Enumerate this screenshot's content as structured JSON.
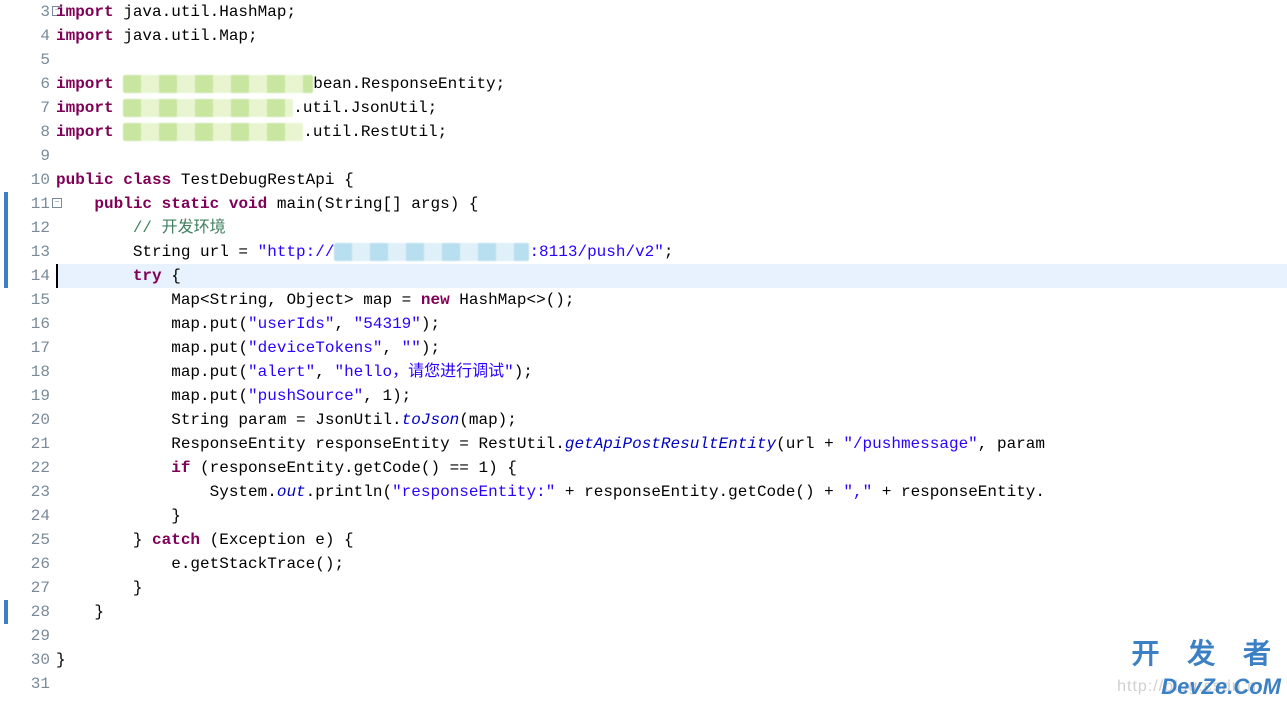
{
  "gutter": {
    "start": 3,
    "end": 31,
    "fold_lines": [
      3,
      11
    ],
    "blue_marker_lines": [
      11,
      12,
      13,
      14,
      28
    ]
  },
  "current_line": 14,
  "code": {
    "l3": {
      "kw": "import",
      "rest": " java.util.HashMap;"
    },
    "l4": {
      "kw": "import",
      "rest": " java.util.Map;"
    },
    "l5": "",
    "l6": {
      "kw": "import",
      "pre": " ",
      "post": "bean.ResponseEntity;"
    },
    "l7": {
      "kw": "import",
      "pre": " ",
      "post": ".util.JsonUtil;"
    },
    "l8": {
      "kw": "import",
      "pre": " ",
      "post": ".util.RestUtil;"
    },
    "l9": "",
    "l10": {
      "kw1": "public",
      "kw2": "class",
      "name": "TestDebugRestApi",
      "brace": " {"
    },
    "l11": {
      "indent": "    ",
      "kw1": "public",
      "kw2": "static",
      "kw3": "void",
      "name": "main",
      "params": "(String[] args) {"
    },
    "l12": {
      "indent": "        ",
      "comment": "// 开发环境"
    },
    "l13": {
      "indent": "        ",
      "type": "String",
      "var": " url = ",
      "str_a": "\"http://",
      "str_b": ":8113/push/v2\"",
      "semi": ";"
    },
    "l14": {
      "indent": "        ",
      "kw": "try",
      "brace": " {"
    },
    "l15": {
      "indent": "            ",
      "type": "Map<String, Object>",
      "var": " map = ",
      "kw": "new",
      "ctor": " HashMap<>();"
    },
    "l16": {
      "indent": "            ",
      "obj": "map.",
      "m": "put",
      "args_a": "(",
      "s1": "\"userIds\"",
      "comma": ", ",
      "s2": "\"54319\"",
      "args_b": ");"
    },
    "l17": {
      "indent": "            ",
      "obj": "map.",
      "m": "put",
      "args_a": "(",
      "s1": "\"deviceTokens\"",
      "comma": ", ",
      "s2": "\"\"",
      "args_b": ");"
    },
    "l18": {
      "indent": "            ",
      "obj": "map.",
      "m": "put",
      "args_a": "(",
      "s1": "\"alert\"",
      "comma": ", ",
      "s2": "\"hello，请您进行调试\"",
      "args_b": ");"
    },
    "l19": {
      "indent": "            ",
      "obj": "map.",
      "m": "put",
      "args_a": "(",
      "s1": "\"pushSource\"",
      "comma": ", ",
      "n": "1",
      "args_b": ");"
    },
    "l20": {
      "indent": "            ",
      "type": "String",
      "var": " param = JsonUtil.",
      "m": "toJson",
      "args": "(map);"
    },
    "l21": {
      "indent": "            ",
      "type": "ResponseEntity",
      "var": " responseEntity = RestUtil.",
      "m": "getApiPostResultEntity",
      "args_a": "(url + ",
      "s": "\"/pushmessage\"",
      "args_b": ", param"
    },
    "l22": {
      "indent": "            ",
      "kw": "if",
      "cond": " (responseEntity.getCode() == 1) {"
    },
    "l23": {
      "indent": "                ",
      "pre": "System.",
      "out": "out",
      "mid": ".println(",
      "s": "\"responseEntity:\"",
      "post": " + responseEntity.getCode() + ",
      "s2": "\",\"",
      "post2": " + responseEntity."
    },
    "l24": {
      "indent": "            ",
      "text": "}"
    },
    "l25": {
      "indent": "        ",
      "close": "} ",
      "kw": "catch",
      "params": " (Exception e) {"
    },
    "l26": {
      "indent": "            ",
      "text": "e.getStackTrace();"
    },
    "l27": {
      "indent": "        ",
      "text": "}"
    },
    "l28": {
      "indent": "    ",
      "text": "}"
    },
    "l29": "",
    "l30": {
      "indent": "",
      "text": "}"
    },
    "l31": ""
  },
  "watermark": {
    "blog": "http://blog.csdn.n",
    "cn": "开 发 者",
    "devze": "DevZe.CoM"
  }
}
